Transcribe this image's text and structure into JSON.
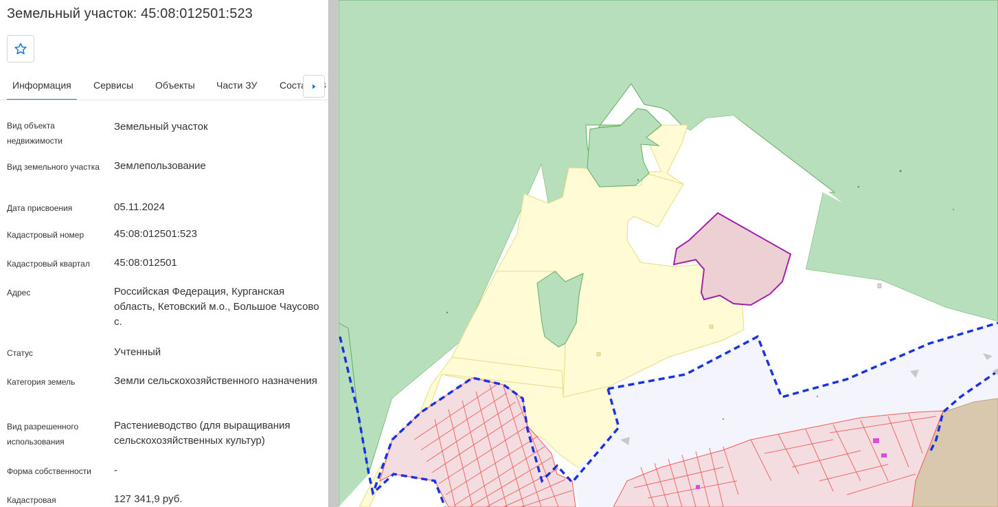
{
  "panel": {
    "title": "Земельный участок: 45:08:012501:523",
    "favorite_icon": "star-outline-icon",
    "tabs": [
      {
        "label": "Информация",
        "active": true
      },
      {
        "label": "Сервисы",
        "active": false
      },
      {
        "label": "Объекты",
        "active": false
      },
      {
        "label": "Части ЗУ",
        "active": false
      },
      {
        "label": "Состав ЕЗ",
        "active": false
      }
    ],
    "tab_scroll_icon": "caret-right-icon",
    "fields": [
      {
        "label": "Вид объекта недвижимости",
        "value": "Земельный участок"
      },
      {
        "label": "Вид земельного участка",
        "value": "Землепользование"
      },
      {
        "label": "Дата присвоения",
        "value": "05.11.2024"
      },
      {
        "label": "Кадастровый номер",
        "value": "45:08:012501:523"
      },
      {
        "label": "Кадастровый квартал",
        "value": "45:08:012501"
      },
      {
        "label": "Адрес",
        "value": "Российская Федерация, Курганская область, Кетовский м.о., Большое Чаусово с."
      },
      {
        "label": "Статус",
        "value": "Учтенный"
      },
      {
        "label": "Категория земель",
        "value": "Земли сельскохозяйственного назначения"
      },
      {
        "label": "Вид разрешенного использования",
        "value": "Растениеводство (для выращивания сельскохозяйственных культур)"
      },
      {
        "label": "Форма собственности",
        "value": "-"
      },
      {
        "label": "Кадастровая",
        "value": "127 341,9 руб."
      }
    ]
  },
  "colors": {
    "accent": "#1976d2",
    "forest": "#b7dfbc",
    "agri": "#fffbd5",
    "selected_parcel": "#ecd0d3",
    "selected_border": "#a020a8",
    "settlement": "#f4f5fc",
    "settlement_border": "#1a33e0",
    "plots": "#f4dde0",
    "plots_border": "#f05a5a",
    "water_land": "#d9c8ae"
  }
}
